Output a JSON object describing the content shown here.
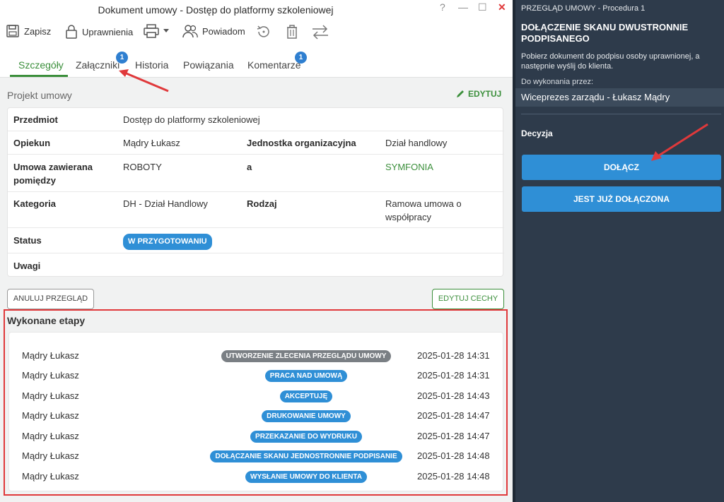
{
  "window": {
    "title": "Dokument umowy - Dostęp do platformy szkoleniowej",
    "help": "?",
    "minimize": "—",
    "maximize": "☐",
    "close": "✕"
  },
  "toolbar": {
    "save": "Zapisz",
    "permissions": "Uprawnienia",
    "notify": "Powiadom"
  },
  "tabs": [
    {
      "label": "Szczegóły"
    },
    {
      "label": "Załączniki",
      "badge": "1"
    },
    {
      "label": "Historia"
    },
    {
      "label": "Powiązania"
    },
    {
      "label": "Komentarze",
      "badge": "1"
    }
  ],
  "section": {
    "title": "Projekt umowy",
    "edit": "EDYTUJ"
  },
  "details": {
    "subject_label": "Przedmiot",
    "subject_value": "Dostęp do platformy szkoleniowej",
    "owner_label": "Opiekun",
    "owner_value": "Mądry Łukasz",
    "unit_label": "Jednostka organizacyjna",
    "unit_value": "Dział handlowy",
    "parties_label": "Umowa zawierana pomiędzy",
    "party_a": "ROBOTY",
    "party_and": "a",
    "party_b": "SYMFONIA",
    "category_label": "Kategoria",
    "category_value": "DH - Dział Handlowy",
    "kind_label": "Rodzaj",
    "kind_value": "Ramowa umowa o współpracy",
    "status_label": "Status",
    "status_value": "W PRZYGOTOWANIU",
    "notes_label": "Uwagi"
  },
  "buttons": {
    "cancel_review": "ANULUJ PRZEGLĄD",
    "edit_features": "EDYTUJ CECHY"
  },
  "stages": {
    "title": "Wykonane etapy",
    "rows": [
      {
        "name": "Mądry Łukasz",
        "stage": "UTWORZENIE ZLECENIA PRZEGLĄDU UMOWY",
        "date": "2025-01-28 14:31",
        "color": "#7a7f84"
      },
      {
        "name": "Mądry Łukasz",
        "stage": "PRACA NAD UMOWĄ",
        "date": "2025-01-28 14:31",
        "color": "#2f8fd6"
      },
      {
        "name": "Mądry Łukasz",
        "stage": "AKCEPTUJĘ",
        "date": "2025-01-28 14:43",
        "color": "#2f8fd6"
      },
      {
        "name": "Mądry Łukasz",
        "stage": "DRUKOWANIE UMOWY",
        "date": "2025-01-28 14:47",
        "color": "#2f8fd6"
      },
      {
        "name": "Mądry Łukasz",
        "stage": "PRZEKAZANIE DO WYDRUKU",
        "date": "2025-01-28 14:47",
        "color": "#2f8fd6"
      },
      {
        "name": "Mądry Łukasz",
        "stage": "DOŁĄCZANIE SKANU JEDNOSTRONNIE PODPISANIE",
        "date": "2025-01-28 14:48",
        "color": "#2f8fd6"
      },
      {
        "name": "Mądry Łukasz",
        "stage": "WYSŁANIE UMOWY DO KLIENTA",
        "date": "2025-01-28 14:48",
        "color": "#2f8fd6"
      }
    ]
  },
  "panel": {
    "header": "PRZEGLĄD UMOWY - Procedura 1",
    "title": "DOŁĄCZENIE SKANU DWUSTRONNIE PODPISANEGO",
    "description": "Pobierz dokument do podpisu osoby uprawnionej, a następnie wyślij do klienta.",
    "assignee_label": "Do wykonania przez:",
    "assignee": "Wiceprezes zarządu - Łukasz Mądry",
    "decision_label": "Decyzja",
    "attach_button": "DOŁĄCZ",
    "already_attached_button": "JEST JUŻ DOŁĄCZONA"
  },
  "colors": {
    "accent_green": "#3b8f3b",
    "accent_blue": "#2f8fd6",
    "panel_bg": "#2e3b4b",
    "highlight_red": "#e0393b"
  }
}
